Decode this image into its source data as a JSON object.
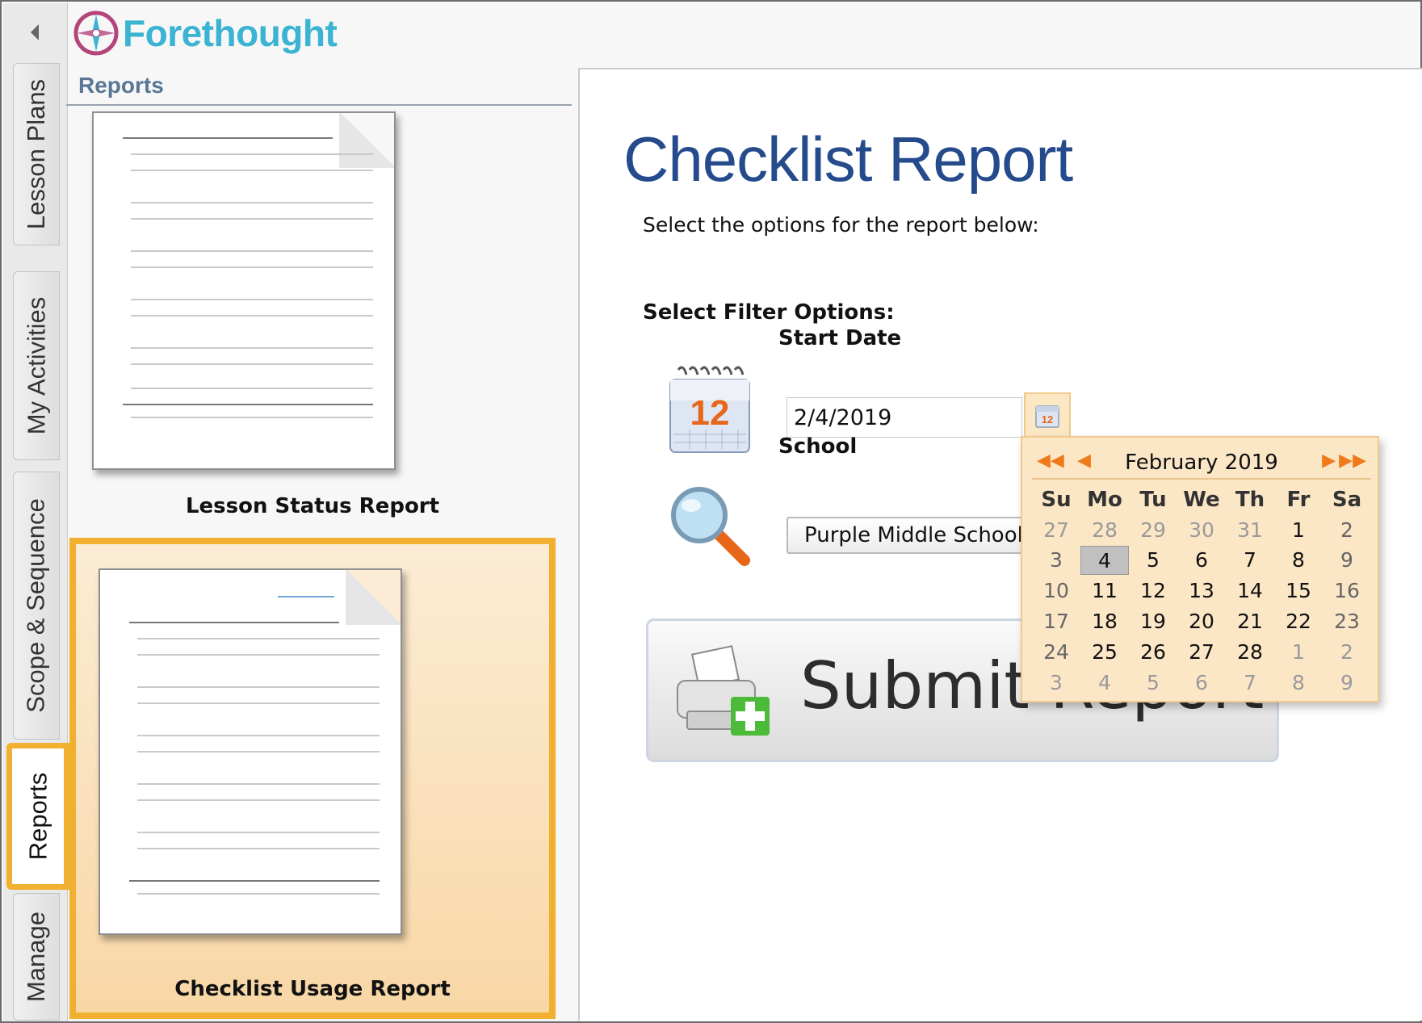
{
  "brand": {
    "name": "Forethought",
    "color": "#3bb3d3"
  },
  "sidebar_tabs": [
    {
      "label": "Lesson Plans",
      "active": false
    },
    {
      "label": "My Activities",
      "active": false
    },
    {
      "label": "Scope & Sequence",
      "active": false
    },
    {
      "label": "Reports",
      "active": true
    },
    {
      "label": "Manage",
      "active": false
    }
  ],
  "reports_panel": {
    "title": "Reports",
    "items": [
      {
        "label": "Lesson Status Report",
        "selected": false
      },
      {
        "label": "Checklist Usage Report",
        "selected": true
      }
    ]
  },
  "main": {
    "heading": "Checklist Report",
    "instruction": "Select the options for the report below:",
    "filter_heading": "Select Filter Options:",
    "start_date": {
      "label": "Start Date",
      "value": "2/4/2019"
    },
    "school": {
      "label": "School",
      "value": "Purple Middle School"
    },
    "submit_label": "Submit Report"
  },
  "calendar": {
    "title": "February 2019",
    "nav": {
      "prev_year": "◀◀",
      "prev_month": "◀",
      "next_month": "▶",
      "next_year": "▶▶"
    },
    "weekdays": [
      "Su",
      "Mo",
      "Tu",
      "We",
      "Th",
      "Fr",
      "Sa"
    ],
    "weeks": [
      [
        "27",
        "28",
        "29",
        "30",
        "31",
        "1",
        "2"
      ],
      [
        "3",
        "4",
        "5",
        "6",
        "7",
        "8",
        "9"
      ],
      [
        "10",
        "11",
        "12",
        "13",
        "14",
        "15",
        "16"
      ],
      [
        "17",
        "18",
        "19",
        "20",
        "21",
        "22",
        "23"
      ],
      [
        "24",
        "25",
        "26",
        "27",
        "28",
        "1",
        "2"
      ],
      [
        "3",
        "4",
        "5",
        "6",
        "7",
        "8",
        "9"
      ]
    ],
    "selected_day": "4"
  },
  "colors": {
    "accent": "#f2b030",
    "heading": "#254b8c",
    "calendar_bg": "#fbe6c6"
  }
}
